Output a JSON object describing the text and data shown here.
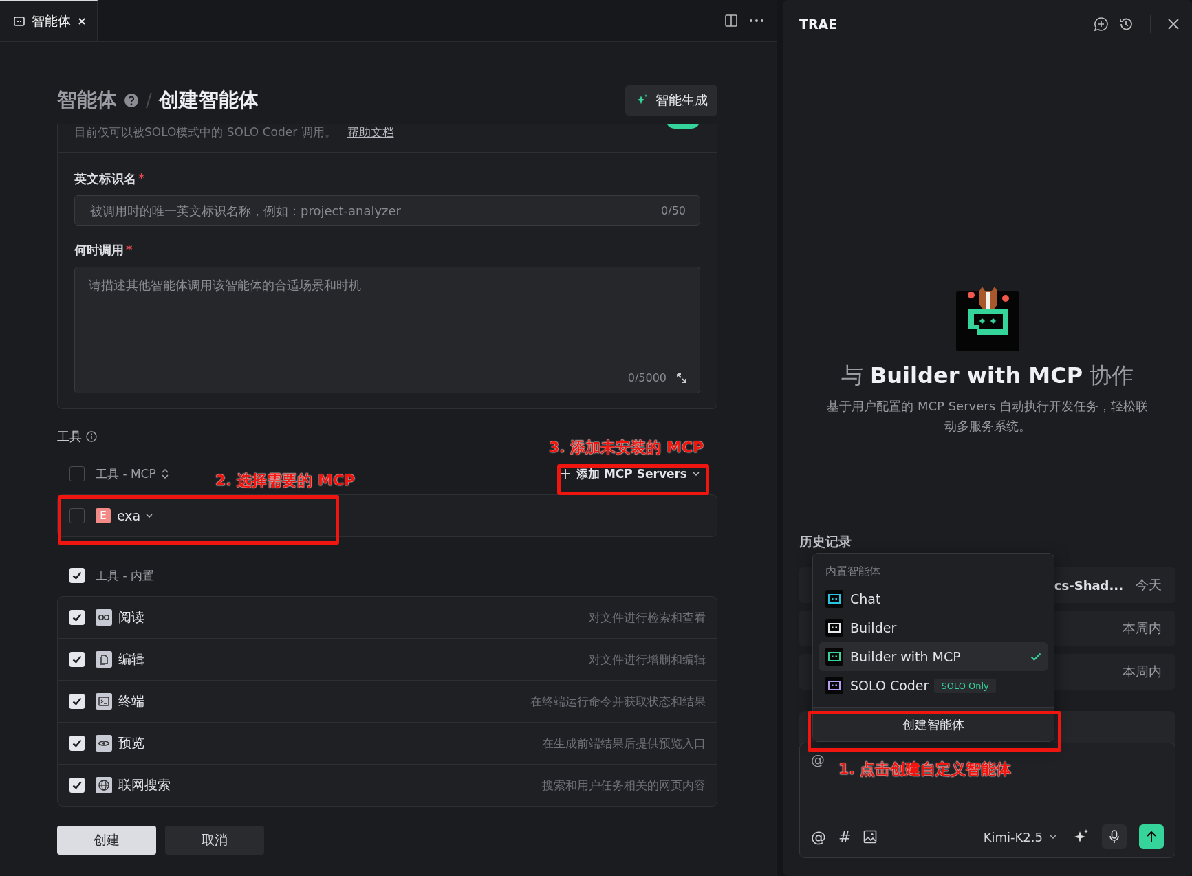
{
  "tab": {
    "label": "智能体",
    "selected": true
  },
  "breadcrumb": {
    "parent": "智能体",
    "separator": "/",
    "current": "创建智能体"
  },
  "generate_button": "智能生成",
  "intro": {
    "text": "目前仅可以被SOLO模式中的 SOLO Coder 调用。",
    "link": "帮助文档",
    "toggle_on": true
  },
  "fields": [
    {
      "kind": "input",
      "label": "英文标识名",
      "required_mark": "*",
      "placeholder": "被调用时的唯一英文标识名称，例如：project-analyzer",
      "counter": "0/50"
    },
    {
      "kind": "textarea",
      "label": "何时调用",
      "required_mark": "*",
      "placeholder": "请描述其他智能体调用该智能体的合适场景和时机",
      "counter": "0/5000"
    }
  ],
  "tools": {
    "title": "工具",
    "mcp_header": {
      "label": "工具 - MCP",
      "checked": false
    },
    "add_button": "添加 MCP Servers",
    "mcp_items": [
      {
        "badge": "E",
        "name": "exa",
        "checked": false
      }
    ],
    "builtin_header": {
      "label": "工具 - 内置",
      "checked": true
    },
    "builtin_items": [
      {
        "name": "阅读",
        "description": "对文件进行检索和查看",
        "checked": true
      },
      {
        "name": "编辑",
        "description": "对文件进行增删和编辑",
        "checked": true
      },
      {
        "name": "终端",
        "description": "在终端运行命令并获取状态和结果",
        "checked": true
      },
      {
        "name": "预览",
        "description": "在生成前端结果后提供预览入口",
        "checked": true
      },
      {
        "name": "联网搜索",
        "description": "搜索和用户任务相关的网页内容",
        "checked": true
      }
    ]
  },
  "actions": [
    {
      "label": "创建",
      "kind": "primary"
    },
    {
      "label": "取消",
      "kind": "secondary"
    }
  ],
  "assistant": {
    "title": "TRAE",
    "agent_title": {
      "prefix": "与",
      "name": "Builder with MCP",
      "suffix": "协作"
    },
    "description": "基于用户配置的 MCP Servers 自动执行开发任务，轻松联动多服务系统。",
    "history_title": "历史记录",
    "history": [
      {
        "title": "cs-Shad...",
        "date": "今天"
      },
      {
        "date": "本周内"
      },
      {
        "date": "本周内"
      }
    ],
    "menu": {
      "section": "内置智能体",
      "items": [
        {
          "name": "Chat",
          "color": "#2cc3e0",
          "selected": false
        },
        {
          "name": "Builder",
          "color": "#e8e9ee",
          "selected": false
        },
        {
          "name": "Builder with MCP",
          "color": "#35d49a",
          "selected": true
        },
        {
          "name": "SOLO Coder",
          "color": "#b49cf5",
          "selected": false,
          "badge": "SOLO Only"
        }
      ],
      "create_button": "创建智能体"
    },
    "input": {
      "placeholder": "@",
      "tools": [
        "@",
        "#"
      ],
      "model": "Kimi-K2.5"
    }
  },
  "annotations": [
    {
      "kind": "box"
    },
    {
      "kind": "box"
    },
    {
      "kind": "box"
    },
    {
      "kind": "label",
      "text": "3. 添加未安装的 MCP"
    },
    {
      "kind": "label",
      "text": "2. 选择需要的 MCP"
    },
    {
      "kind": "label",
      "text": "1. 点击创建自定义智能体"
    }
  ]
}
